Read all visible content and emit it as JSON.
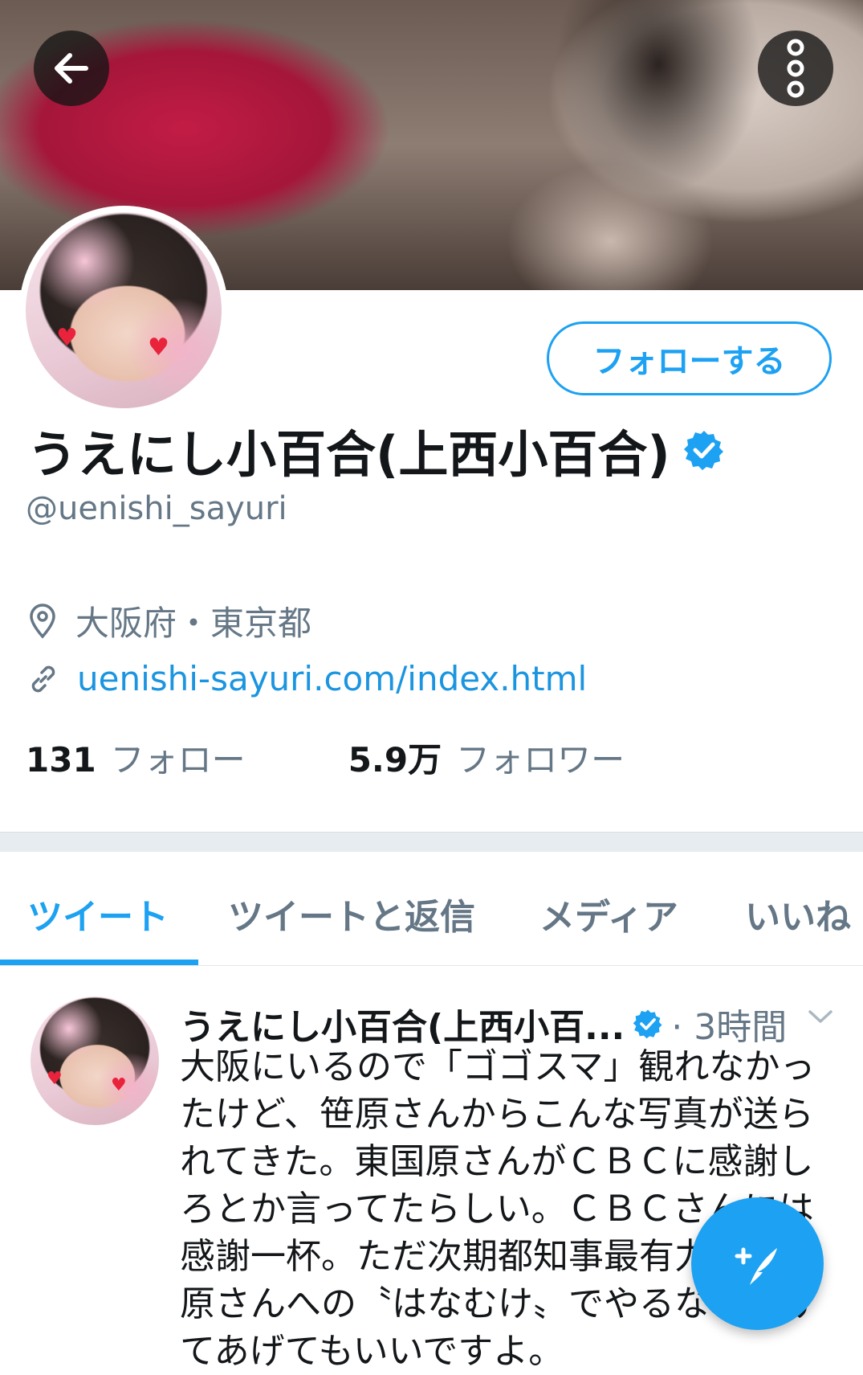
{
  "header": {
    "back_icon": "arrow-left-icon",
    "more_icon": "more-vertical-icon"
  },
  "profile": {
    "display_name": "うえにし小百合(上西小百合)",
    "handle": "@uenishi_sayuri",
    "follow_button": "フォローする",
    "location": "大阪府・東京都",
    "url": "uenishi-sayuri.com/index.html",
    "following_count": "131",
    "following_label": "フォロー",
    "followers_count": "5.9万",
    "followers_label": "フォロワー"
  },
  "tabs": [
    {
      "label": "ツイート",
      "active": true
    },
    {
      "label": "ツイートと返信",
      "active": false
    },
    {
      "label": "メディア",
      "active": false
    },
    {
      "label": "いいね",
      "active": false
    }
  ],
  "tweet": {
    "author": "うえにし小百合(上西小百...",
    "time": "· 3時間",
    "text": "大阪にいるので「ゴゴスマ」観れなかったけど、笹原さんからこんな写真が送られてきた。東国原さんがＣＢＣに感謝しろとか言ってたらしい。ＣＢＣさんには感謝一杯。ただ次期都知事最有力の東国原さんへの〝はなむけ〟でやるなら受けてあげてもいいですよ。"
  },
  "colors": {
    "accent": "#1da1f2",
    "secondary_text": "#657786"
  }
}
